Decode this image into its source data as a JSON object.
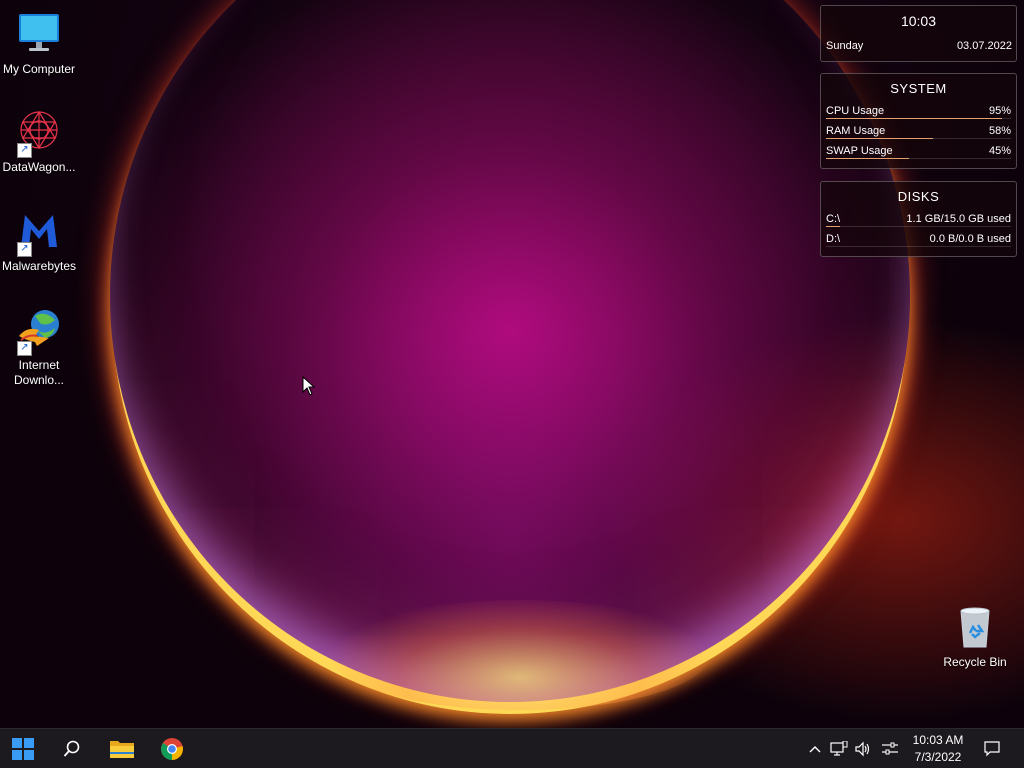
{
  "desktop_icons": [
    {
      "label": "My Computer",
      "icon": "monitor-icon"
    },
    {
      "label": "DataWagon...",
      "icon": "datawagon-icon",
      "shortcut": true
    },
    {
      "label": "Malwarebytes",
      "icon": "malwarebytes-icon",
      "shortcut": true
    },
    {
      "label": "Internet Downlo...",
      "icon": "internet-download-manager-icon",
      "shortcut": true
    },
    {
      "label": "Recycle Bin",
      "icon": "recycle-bin-icon"
    }
  ],
  "widgets": {
    "clock": {
      "time": "10:03",
      "day": "Sunday",
      "date": "03.07.2022"
    },
    "system": {
      "title": "SYSTEM",
      "rows": [
        {
          "label": "CPU Usage",
          "value": "95%",
          "level": 0.95
        },
        {
          "label": "RAM Usage",
          "value": "58%",
          "level": 0.58
        },
        {
          "label": "SWAP Usage",
          "value": "45%",
          "level": 0.45
        }
      ]
    },
    "disks": {
      "title": "DISKS",
      "rows": [
        {
          "label": "C:\\",
          "value": "1.1 GB/15.0 GB used",
          "level": 0.073
        },
        {
          "label": "D:\\",
          "value": "0.0 B/0.0 B used",
          "level": 0.0
        }
      ]
    }
  },
  "taskbar": {
    "pinned": [
      {
        "name": "start-button",
        "icon": "windows-logo-icon"
      },
      {
        "name": "search-button",
        "icon": "search-icon"
      },
      {
        "name": "file-explorer-button",
        "icon": "folder-icon"
      },
      {
        "name": "chrome-button",
        "icon": "chrome-icon"
      }
    ],
    "tray": {
      "time": "10:03 AM",
      "date": "7/3/2022"
    }
  },
  "colors": {
    "bar_fill": "#e3a071",
    "taskbar_bg": "#1d1a1f",
    "windows_blue": "#3a9bf5"
  }
}
